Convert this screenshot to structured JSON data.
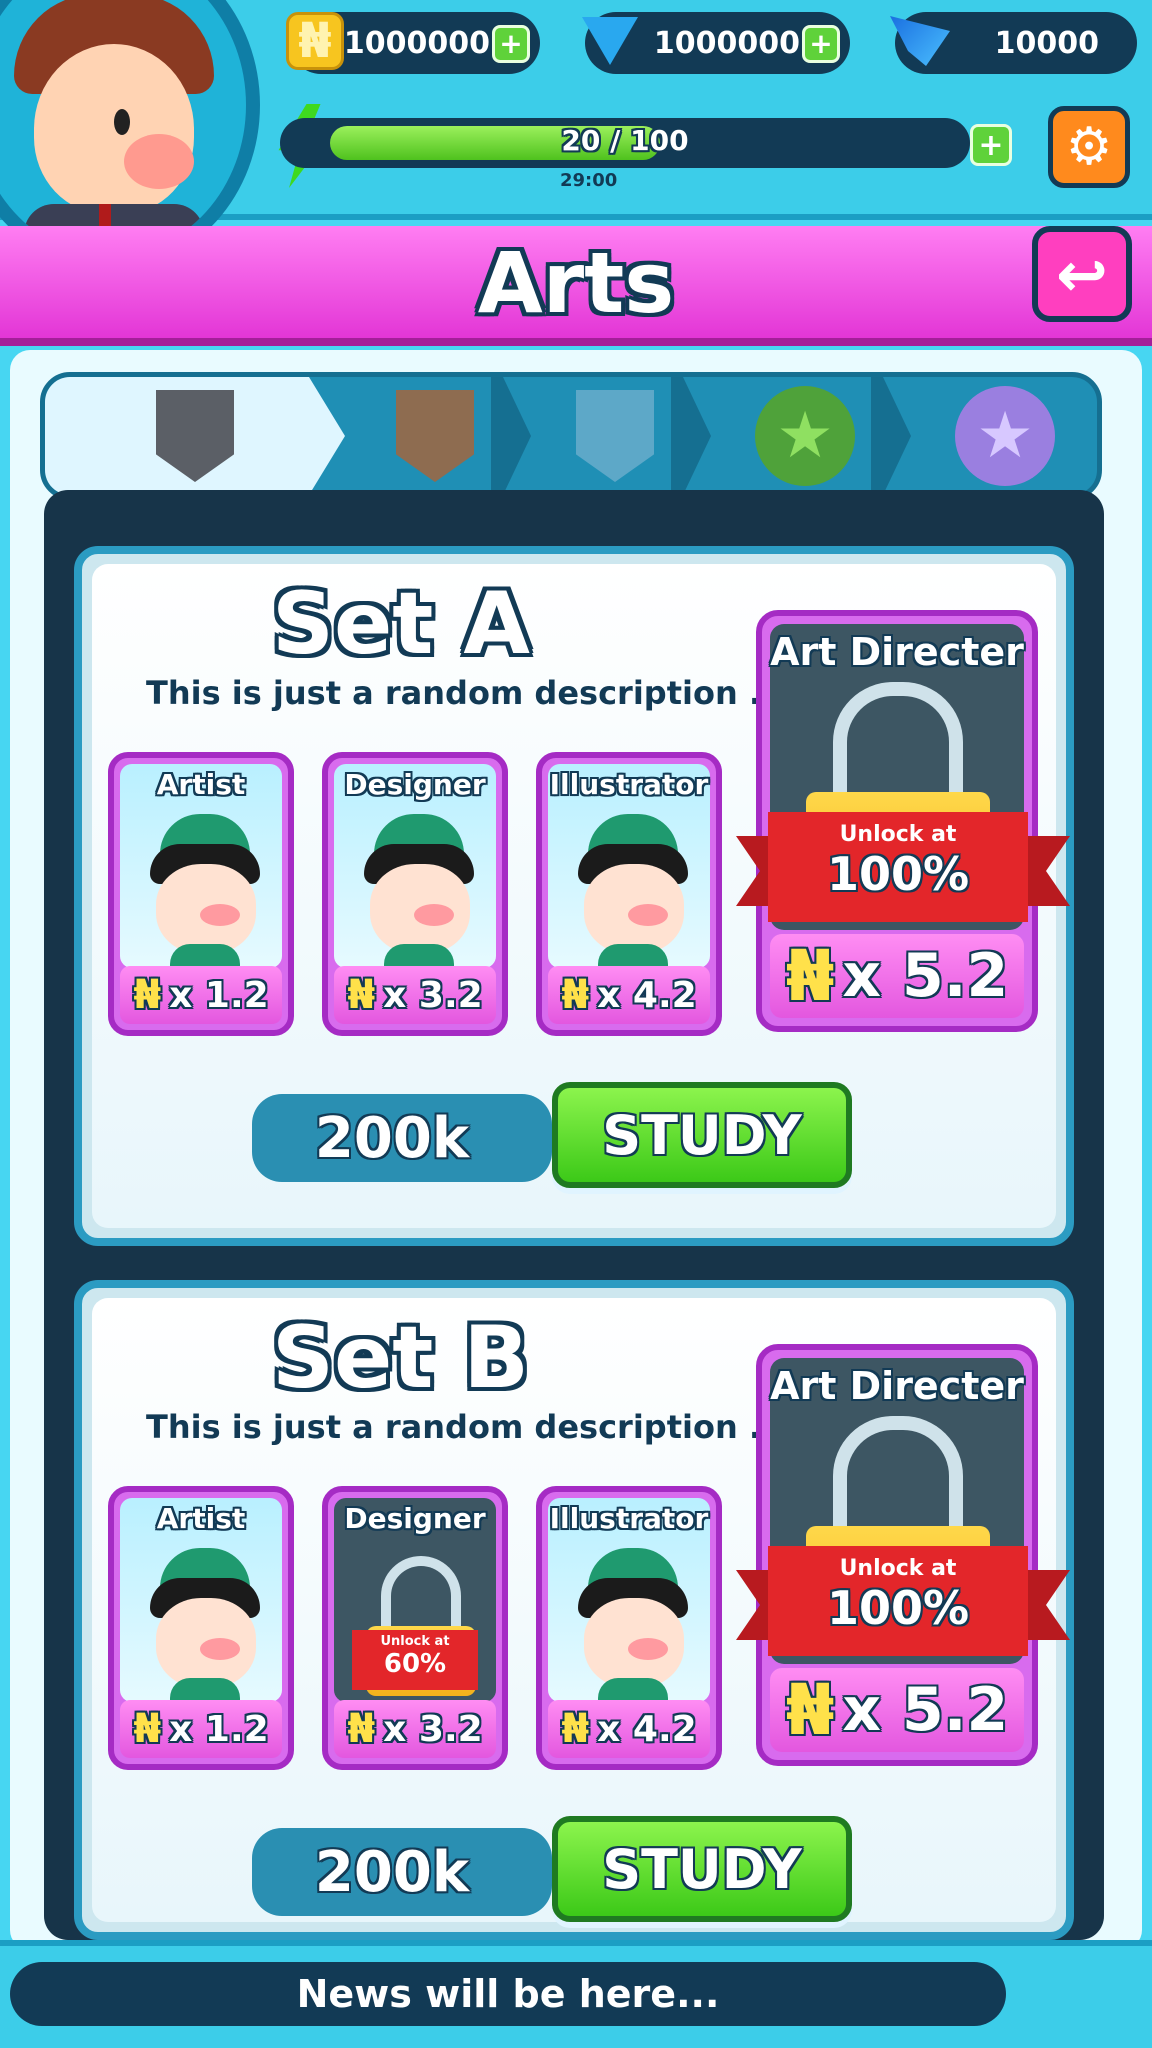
{
  "hud": {
    "coins": "1000000",
    "gems": "1000000",
    "wings": "10000",
    "energy_text": "20 / 100",
    "energy_fraction": 0.2,
    "timer": "29:00",
    "currency_symbol": "₦",
    "plus": "+"
  },
  "title": "Arts",
  "tabs": [
    {
      "name": "tier-1",
      "color": "#5b5f66",
      "active": true
    },
    {
      "name": "tier-2",
      "color": "#8e6c50",
      "active": false
    },
    {
      "name": "tier-3",
      "color": "#5da8c8",
      "active": false
    },
    {
      "name": "tier-4",
      "color": "#4fa23a",
      "active": false
    },
    {
      "name": "tier-5",
      "color": "#9a7fe0",
      "active": false
    }
  ],
  "sets": [
    {
      "title": "Set A",
      "description": "This is  just a random description .",
      "cards": [
        {
          "name": "Artist",
          "mult": "x 1.2",
          "locked": false
        },
        {
          "name": "Designer",
          "mult": "x 3.2",
          "locked": false
        },
        {
          "name": "Illustrator",
          "mult": "x 4.2",
          "locked": false
        }
      ],
      "director": {
        "name": "Art Directer",
        "mult": "x 5.2",
        "unlock_label": "Unlock at",
        "unlock_value": "100%"
      },
      "cost": "200k",
      "study_label": "STUDY"
    },
    {
      "title": "Set B",
      "description": "This is  just a random description .",
      "cards": [
        {
          "name": "Artist",
          "mult": "x 1.2",
          "locked": false
        },
        {
          "name": "Designer",
          "mult": "x 3.2",
          "locked": true,
          "unlock_label": "Unlock at",
          "unlock_value": "60%"
        },
        {
          "name": "Illustrator",
          "mult": "x 4.2",
          "locked": false
        }
      ],
      "director": {
        "name": "Art Directer",
        "mult": "x 5.2",
        "unlock_label": "Unlock at",
        "unlock_value": "100%"
      },
      "cost": "200k",
      "study_label": "STUDY"
    }
  ],
  "news": "News will be here..."
}
